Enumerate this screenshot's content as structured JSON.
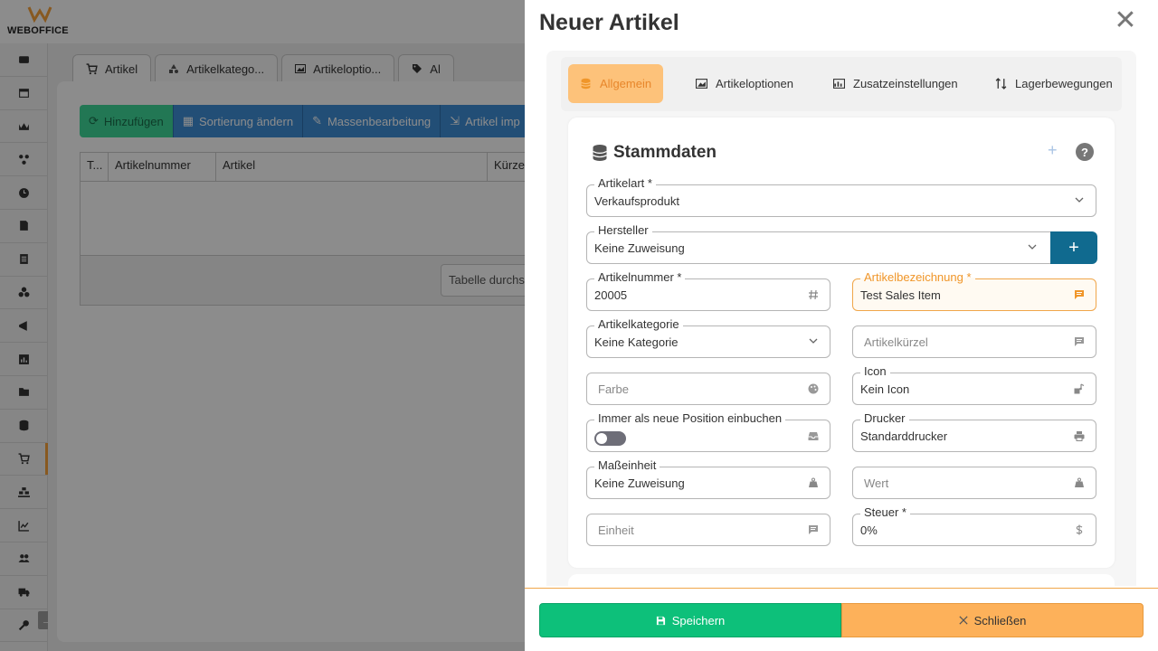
{
  "app": {
    "logo_text": "WEBOFFICE",
    "brand_color": "#f7a23b"
  },
  "sidebar": {
    "items": [
      {
        "icon": "cash-register-icon"
      },
      {
        "icon": "calendar-icon"
      },
      {
        "icon": "crown-icon"
      },
      {
        "icon": "network-icon"
      },
      {
        "icon": "clock-icon"
      },
      {
        "icon": "document-icon"
      },
      {
        "icon": "list-document-icon"
      },
      {
        "icon": "boxes-icon"
      },
      {
        "icon": "megaphone-icon"
      },
      {
        "icon": "chart-icon"
      },
      {
        "icon": "folder-icon"
      },
      {
        "icon": "database-icon"
      },
      {
        "icon": "cart-icon",
        "active": true
      },
      {
        "icon": "warehouse-icon"
      },
      {
        "icon": "line-chart-icon"
      },
      {
        "icon": "users-icon"
      },
      {
        "icon": "truck-icon"
      },
      {
        "icon": "key-icon"
      }
    ],
    "collapse_arrow": "→"
  },
  "background": {
    "tabs": [
      {
        "label": "Artikel",
        "icon": "cart-icon"
      },
      {
        "label": "Artikelkatego...",
        "icon": "shapes-icon"
      },
      {
        "label": "Artikeloptio...",
        "icon": "image-icon"
      },
      {
        "label": "Al",
        "icon": "tag-icon"
      }
    ],
    "toolbar": {
      "add": "Hinzufügen",
      "sort": "Sortierung ändern",
      "bulk": "Massenbearbeitung",
      "import": "Artikel imp"
    },
    "grid": {
      "columns": [
        "T...",
        "Artikelnummer",
        "Artikel",
        "Kürze"
      ],
      "search_placeholder": "Tabelle durchs"
    }
  },
  "modal": {
    "title": "Neuer Artikel",
    "close_symbol": "✕",
    "tabs": [
      {
        "label": "Allgemein",
        "icon": "database-icon",
        "active": true
      },
      {
        "label": "Artikeloptionen",
        "icon": "image-icon"
      },
      {
        "label": "Zusatzeinstellungen",
        "icon": "sliders-icon"
      },
      {
        "label": "Lagerbewegungen",
        "icon": "sort-arrows-icon"
      }
    ],
    "section": {
      "title": "Stammdaten",
      "plus": "+",
      "help": "?"
    },
    "fields": {
      "artikelart": {
        "label": "Artikelart *",
        "value": "Verkaufsprodukt"
      },
      "hersteller": {
        "label": "Hersteller",
        "value": "Keine Zuweisung",
        "add": "+"
      },
      "artikelnummer": {
        "label": "Artikelnummer *",
        "value": "20005"
      },
      "artikelbezeichnung": {
        "label": "Artikelbezeichnung *",
        "value": "Test Sales Item"
      },
      "artikelkategorie": {
        "label": "Artikelkategorie",
        "value": "Keine Kategorie"
      },
      "artikelkuerzel": {
        "placeholder": "Artikelkürzel"
      },
      "farbe": {
        "placeholder": "Farbe"
      },
      "icon": {
        "label": "Icon",
        "value": "Kein Icon"
      },
      "immer_neue_position": {
        "label": "Immer als neue Position einbuchen",
        "checked": false
      },
      "drucker": {
        "label": "Drucker",
        "value": "Standarddrucker"
      },
      "masseinheit": {
        "label": "Maßeinheit",
        "value": "Keine Zuweisung"
      },
      "wert": {
        "placeholder": "Wert"
      },
      "einheit": {
        "placeholder": "Einheit"
      },
      "steuer": {
        "label": "Steuer *",
        "value": "0%"
      }
    },
    "footer": {
      "save": "Speichern",
      "close": "Schließen"
    }
  }
}
